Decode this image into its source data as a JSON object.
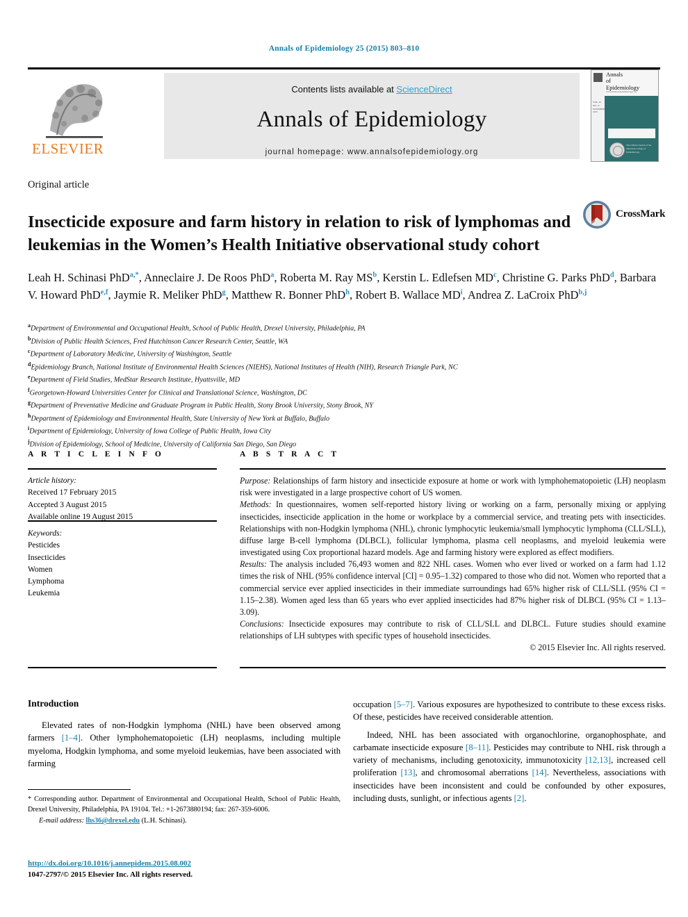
{
  "running_head": "Annals of Epidemiology 25 (2015) 803–810",
  "masthead": {
    "publisher_name": "ELSEVIER",
    "contents_prefix": "Contents lists available at ",
    "contents_link": "ScienceDirect",
    "journal_name": "Annals of Epidemiology",
    "homepage_line": "journal homepage: www.annalsofepidemiology.org",
    "cover": {
      "title_line1": "Annals",
      "title_line2": "of",
      "title_line3": "Epidemiology",
      "subtitle": "www.annalsofepidemiology.org",
      "side_text": "VOL. 25   NO. 11   NOVEMBER 2015",
      "seal_text": "The Official Journal of the American College of Epidemiology"
    }
  },
  "article": {
    "type": "Original article",
    "title": "Insecticide exposure and farm history in relation to risk of lymphomas and leukemias in the Women’s Health Initiative observational study cohort",
    "crossmark_label": "CrossMark"
  },
  "authors": [
    {
      "name": "Leah H. Schinasi PhD",
      "marks": "a,*",
      "sep": ", "
    },
    {
      "name": "Anneclaire J. De Roos PhD",
      "marks": "a",
      "sep": ", "
    },
    {
      "name": "Roberta M. Ray MS",
      "marks": "b",
      "sep": ", "
    },
    {
      "name": "Kerstin L. Edlefsen MD",
      "marks": "c",
      "sep": ", "
    },
    {
      "name": "Christine G. Parks PhD",
      "marks": "d",
      "sep": ", "
    },
    {
      "name": "Barbara V. Howard PhD",
      "marks": "e,f",
      "sep": ", "
    },
    {
      "name": "Jaymie R. Meliker PhD",
      "marks": "g",
      "sep": ", "
    },
    {
      "name": "Matthew R. Bonner PhD",
      "marks": "h",
      "sep": ", "
    },
    {
      "name": "Robert B. Wallace MD",
      "marks": "i",
      "sep": ", "
    },
    {
      "name": "Andrea Z. LaCroix PhD",
      "marks": "b,j",
      "sep": ""
    }
  ],
  "affiliations": [
    {
      "mark": "a",
      "text": "Department of Environmental and Occupational Health, School of Public Health, Drexel University, Philadelphia, PA"
    },
    {
      "mark": "b",
      "text": "Division of Public Health Sciences, Fred Hutchinson Cancer Research Center, Seattle, WA"
    },
    {
      "mark": "c",
      "text": "Department of Laboratory Medicine, University of Washington, Seattle"
    },
    {
      "mark": "d",
      "text": "Epidemiology Branch, National Institute of Environmental Health Sciences (NIEHS), National Institutes of Health (NIH), Research Triangle Park, NC"
    },
    {
      "mark": "e",
      "text": "Department of Field Studies, MedStar Research Institute, Hyattsville, MD"
    },
    {
      "mark": "f",
      "text": "Georgetown-Howard Universities Center for Clinical and Translational Science, Washington, DC"
    },
    {
      "mark": "g",
      "text": "Department of Preventative Medicine and Graduate Program in Public Health, Stony Brook University, Stony Brook, NY"
    },
    {
      "mark": "h",
      "text": "Department of Epidemiology and Environmental Health, State University of New York at Buffalo, Buffalo"
    },
    {
      "mark": "i",
      "text": "Department of Epidemiology, University of Iowa College of Public Health, Iowa City"
    },
    {
      "mark": "j",
      "text": "Division of Epidemiology, School of Medicine, University of California San Diego, San Diego"
    }
  ],
  "article_info": {
    "heading": "A R T I C L E   I N F O",
    "history_label": "Article history:",
    "received": "Received 17 February 2015",
    "accepted": "Accepted 3 August 2015",
    "available": "Available online 19 August 2015",
    "keywords_label": "Keywords:",
    "keywords": [
      "Pesticides",
      "Insecticides",
      "Women",
      "Lymphoma",
      "Leukemia"
    ]
  },
  "abstract": {
    "heading": "A B S T R A C T",
    "purpose_label": "Purpose:",
    "purpose": " Relationships of farm history and insecticide exposure at home or work with lymphohematopoietic (LH) neoplasm risk were investigated in a large prospective cohort of US women.",
    "methods_label": "Methods:",
    "methods": " In questionnaires, women self-reported history living or working on a farm, personally mixing or applying insecticides, insecticide application in the home or workplace by a commercial service, and treating pets with insecticides. Relationships with non-Hodgkin lymphoma (NHL), chronic lymphocytic leukemia/small lymphocytic lymphoma (CLL/SLL), diffuse large B-cell lymphoma (DLBCL), follicular lymphoma, plasma cell neoplasms, and myeloid leukemia were investigated using Cox proportional hazard models. Age and farming history were explored as effect modifiers.",
    "results_label": "Results:",
    "results": " The analysis included 76,493 women and 822 NHL cases. Women who ever lived or worked on a farm had 1.12 times the risk of NHL (95% confidence interval [CI] = 0.95–1.32) compared to those who did not. Women who reported that a commercial service ever applied insecticides in their immediate surroundings had 65% higher risk of CLL/SLL (95% CI = 1.15–2.38). Women aged less than 65 years who ever applied insecticides had 87% higher risk of DLBCL (95% CI = 1.13–3.09).",
    "conclusions_label": "Conclusions:",
    "conclusions": " Insecticide exposures may contribute to risk of CLL/SLL and DLBCL. Future studies should examine relationships of LH subtypes with specific types of household insecticides.",
    "copyright": "© 2015 Elsevier Inc. All rights reserved."
  },
  "body": {
    "intro_heading": "Introduction",
    "left_paragraph_1_a": "Elevated rates of non-Hodgkin lymphoma (NHL) have been observed among farmers ",
    "left_paragraph_1_ref": "[1–4]",
    "left_paragraph_1_b": ". Other lymphohematopoietic (LH) neoplasms, including multiple myeloma, Hodgkin lymphoma, and some myeloid leukemias, have been associated with farming",
    "right_paragraph_1_a": "occupation ",
    "right_paragraph_1_ref": "[5–7]",
    "right_paragraph_1_b": ". Various exposures are hypothesized to contribute to these excess risks. Of these, pesticides have received considerable attention.",
    "right_paragraph_2_a": "Indeed, NHL has been associated with organochlorine, organophosphate, and carbamate insecticide exposure ",
    "right_paragraph_2_ref1": "[8–11]",
    "right_paragraph_2_b": ". Pesticides may contribute to NHL risk through a variety of mechanisms, including genotoxicity, immunotoxicity ",
    "right_paragraph_2_ref2": "[12,13]",
    "right_paragraph_2_c": ", increased cell proliferation ",
    "right_paragraph_2_ref3": "[13]",
    "right_paragraph_2_d": ", and chromosomal aberrations ",
    "right_paragraph_2_ref4": "[14]",
    "right_paragraph_2_e": ". Nevertheless, associations with insecticides have been inconsistent and could be confounded by other exposures, including dusts, sunlight, or infectious agents ",
    "right_paragraph_2_ref5": "[2]",
    "right_paragraph_2_f": "."
  },
  "footnotes": {
    "corresponding": "* Corresponding author. Department of Environmental and Occupational Health, School of Public Health, Drexel University, Philadelphia, PA 19104. Tel.: +1-2673880194; fax: 267-359-6006.",
    "email_label": "E-mail address:",
    "email": "lhs36@drexel.edu",
    "email_suffix": " (L.H. Schinasi).",
    "doi": "http://dx.doi.org/10.1016/j.annepidem.2015.08.002",
    "issn_a": "1047-2797/",
    "issn_b": "© 2015 Elsevier Inc. All rights reserved."
  },
  "colors": {
    "link_blue": "#1a7fa8",
    "sciencedirect_blue": "#2e9fd4",
    "elsevier_orange": "#E87B1E",
    "cover_teal": "#2d6e6e",
    "crossmark_red": "#b0281f"
  }
}
